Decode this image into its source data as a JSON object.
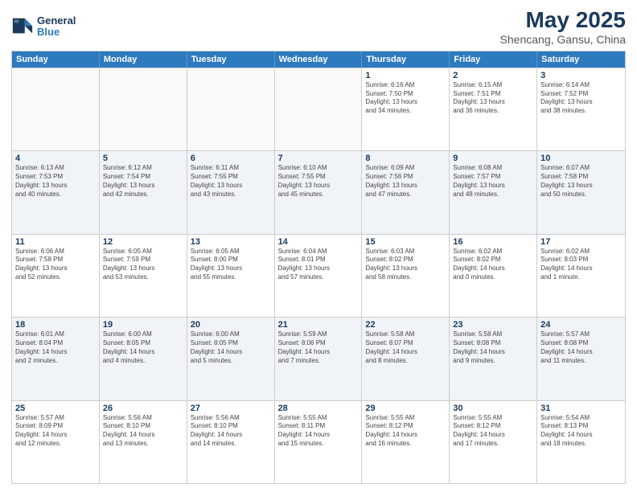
{
  "header": {
    "logo_line1": "General",
    "logo_line2": "Blue",
    "title": "May 2025",
    "subtitle": "Shencang, Gansu, China"
  },
  "weekdays": [
    "Sunday",
    "Monday",
    "Tuesday",
    "Wednesday",
    "Thursday",
    "Friday",
    "Saturday"
  ],
  "rows": [
    [
      {
        "num": "",
        "info": "",
        "empty": true
      },
      {
        "num": "",
        "info": "",
        "empty": true
      },
      {
        "num": "",
        "info": "",
        "empty": true
      },
      {
        "num": "",
        "info": "",
        "empty": true
      },
      {
        "num": "1",
        "info": "Sunrise: 6:16 AM\nSunset: 7:50 PM\nDaylight: 13 hours\nand 34 minutes."
      },
      {
        "num": "2",
        "info": "Sunrise: 6:15 AM\nSunset: 7:51 PM\nDaylight: 13 hours\nand 36 minutes."
      },
      {
        "num": "3",
        "info": "Sunrise: 6:14 AM\nSunset: 7:52 PM\nDaylight: 13 hours\nand 38 minutes."
      }
    ],
    [
      {
        "num": "4",
        "info": "Sunrise: 6:13 AM\nSunset: 7:53 PM\nDaylight: 13 hours\nand 40 minutes."
      },
      {
        "num": "5",
        "info": "Sunrise: 6:12 AM\nSunset: 7:54 PM\nDaylight: 13 hours\nand 42 minutes."
      },
      {
        "num": "6",
        "info": "Sunrise: 6:11 AM\nSunset: 7:55 PM\nDaylight: 13 hours\nand 43 minutes."
      },
      {
        "num": "7",
        "info": "Sunrise: 6:10 AM\nSunset: 7:55 PM\nDaylight: 13 hours\nand 45 minutes."
      },
      {
        "num": "8",
        "info": "Sunrise: 6:09 AM\nSunset: 7:56 PM\nDaylight: 13 hours\nand 47 minutes."
      },
      {
        "num": "9",
        "info": "Sunrise: 6:08 AM\nSunset: 7:57 PM\nDaylight: 13 hours\nand 48 minutes."
      },
      {
        "num": "10",
        "info": "Sunrise: 6:07 AM\nSunset: 7:58 PM\nDaylight: 13 hours\nand 50 minutes."
      }
    ],
    [
      {
        "num": "11",
        "info": "Sunrise: 6:06 AM\nSunset: 7:58 PM\nDaylight: 13 hours\nand 52 minutes."
      },
      {
        "num": "12",
        "info": "Sunrise: 6:05 AM\nSunset: 7:59 PM\nDaylight: 13 hours\nand 53 minutes."
      },
      {
        "num": "13",
        "info": "Sunrise: 6:05 AM\nSunset: 8:00 PM\nDaylight: 13 hours\nand 55 minutes."
      },
      {
        "num": "14",
        "info": "Sunrise: 6:04 AM\nSunset: 8:01 PM\nDaylight: 13 hours\nand 57 minutes."
      },
      {
        "num": "15",
        "info": "Sunrise: 6:03 AM\nSunset: 8:02 PM\nDaylight: 13 hours\nand 58 minutes."
      },
      {
        "num": "16",
        "info": "Sunrise: 6:02 AM\nSunset: 8:02 PM\nDaylight: 14 hours\nand 0 minutes."
      },
      {
        "num": "17",
        "info": "Sunrise: 6:02 AM\nSunset: 8:03 PM\nDaylight: 14 hours\nand 1 minute."
      }
    ],
    [
      {
        "num": "18",
        "info": "Sunrise: 6:01 AM\nSunset: 8:04 PM\nDaylight: 14 hours\nand 2 minutes."
      },
      {
        "num": "19",
        "info": "Sunrise: 6:00 AM\nSunset: 8:05 PM\nDaylight: 14 hours\nand 4 minutes."
      },
      {
        "num": "20",
        "info": "Sunrise: 6:00 AM\nSunset: 8:05 PM\nDaylight: 14 hours\nand 5 minutes."
      },
      {
        "num": "21",
        "info": "Sunrise: 5:59 AM\nSunset: 8:06 PM\nDaylight: 14 hours\nand 7 minutes."
      },
      {
        "num": "22",
        "info": "Sunrise: 5:58 AM\nSunset: 8:07 PM\nDaylight: 14 hours\nand 8 minutes."
      },
      {
        "num": "23",
        "info": "Sunrise: 5:58 AM\nSunset: 8:08 PM\nDaylight: 14 hours\nand 9 minutes."
      },
      {
        "num": "24",
        "info": "Sunrise: 5:57 AM\nSunset: 8:08 PM\nDaylight: 14 hours\nand 11 minutes."
      }
    ],
    [
      {
        "num": "25",
        "info": "Sunrise: 5:57 AM\nSunset: 8:09 PM\nDaylight: 14 hours\nand 12 minutes."
      },
      {
        "num": "26",
        "info": "Sunrise: 5:56 AM\nSunset: 8:10 PM\nDaylight: 14 hours\nand 13 minutes."
      },
      {
        "num": "27",
        "info": "Sunrise: 5:56 AM\nSunset: 8:10 PM\nDaylight: 14 hours\nand 14 minutes."
      },
      {
        "num": "28",
        "info": "Sunrise: 5:55 AM\nSunset: 8:11 PM\nDaylight: 14 hours\nand 15 minutes."
      },
      {
        "num": "29",
        "info": "Sunrise: 5:55 AM\nSunset: 8:12 PM\nDaylight: 14 hours\nand 16 minutes."
      },
      {
        "num": "30",
        "info": "Sunrise: 5:55 AM\nSunset: 8:12 PM\nDaylight: 14 hours\nand 17 minutes."
      },
      {
        "num": "31",
        "info": "Sunrise: 5:54 AM\nSunset: 8:13 PM\nDaylight: 14 hours\nand 18 minutes."
      }
    ]
  ]
}
